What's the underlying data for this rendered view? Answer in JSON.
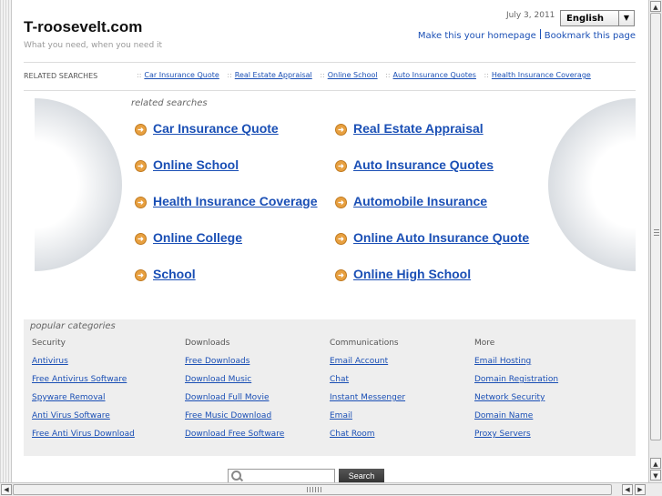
{
  "header": {
    "site_title": "T-roosevelt.com",
    "tagline": "What you need, when you need it",
    "date": "July 3, 2011",
    "language": "English",
    "homepage_link": "Make this your homepage",
    "bookmark_link": "Bookmark this page"
  },
  "related_bar": {
    "label": "RELATED SEARCHES",
    "separator": "::",
    "links": [
      "Car Insurance Quote",
      "Real Estate Appraisal",
      "Online School",
      "Auto Insurance Quotes",
      "Health Insurance Coverage"
    ]
  },
  "related_searches": {
    "heading": "related searches",
    "left": [
      "Car Insurance Quote",
      "Online School",
      "Health Insurance Coverage",
      "Online College",
      "School"
    ],
    "right": [
      "Real Estate Appraisal",
      "Auto Insurance Quotes",
      "Automobile Insurance",
      "Online Auto Insurance Quote",
      "Online High School"
    ]
  },
  "popular": {
    "heading": "popular categories",
    "columns": [
      {
        "title": "Security",
        "links": [
          "Antivirus",
          "Free Antivirus Software",
          "Spyware Removal",
          "Anti Virus Software",
          "Free Anti Virus Download"
        ]
      },
      {
        "title": "Downloads",
        "links": [
          "Free Downloads",
          "Download Music",
          "Download Full Movie",
          "Free Music Download",
          "Download Free Software"
        ]
      },
      {
        "title": "Communications",
        "links": [
          "Email Account",
          "Chat",
          "Instant Messenger",
          "Email",
          "Chat Room"
        ]
      },
      {
        "title": "More",
        "links": [
          "Email Hosting",
          "Domain Registration",
          "Network Security",
          "Domain Name",
          "Proxy Servers"
        ]
      }
    ]
  },
  "search": {
    "value": "",
    "button_label": "Search"
  },
  "icons": {
    "bullet": "arrow-circle-icon",
    "search": "magnifier-icon"
  },
  "colors": {
    "link": "#1a4fb5",
    "bullet": "#e8a040",
    "panel": "#eeeeee"
  }
}
